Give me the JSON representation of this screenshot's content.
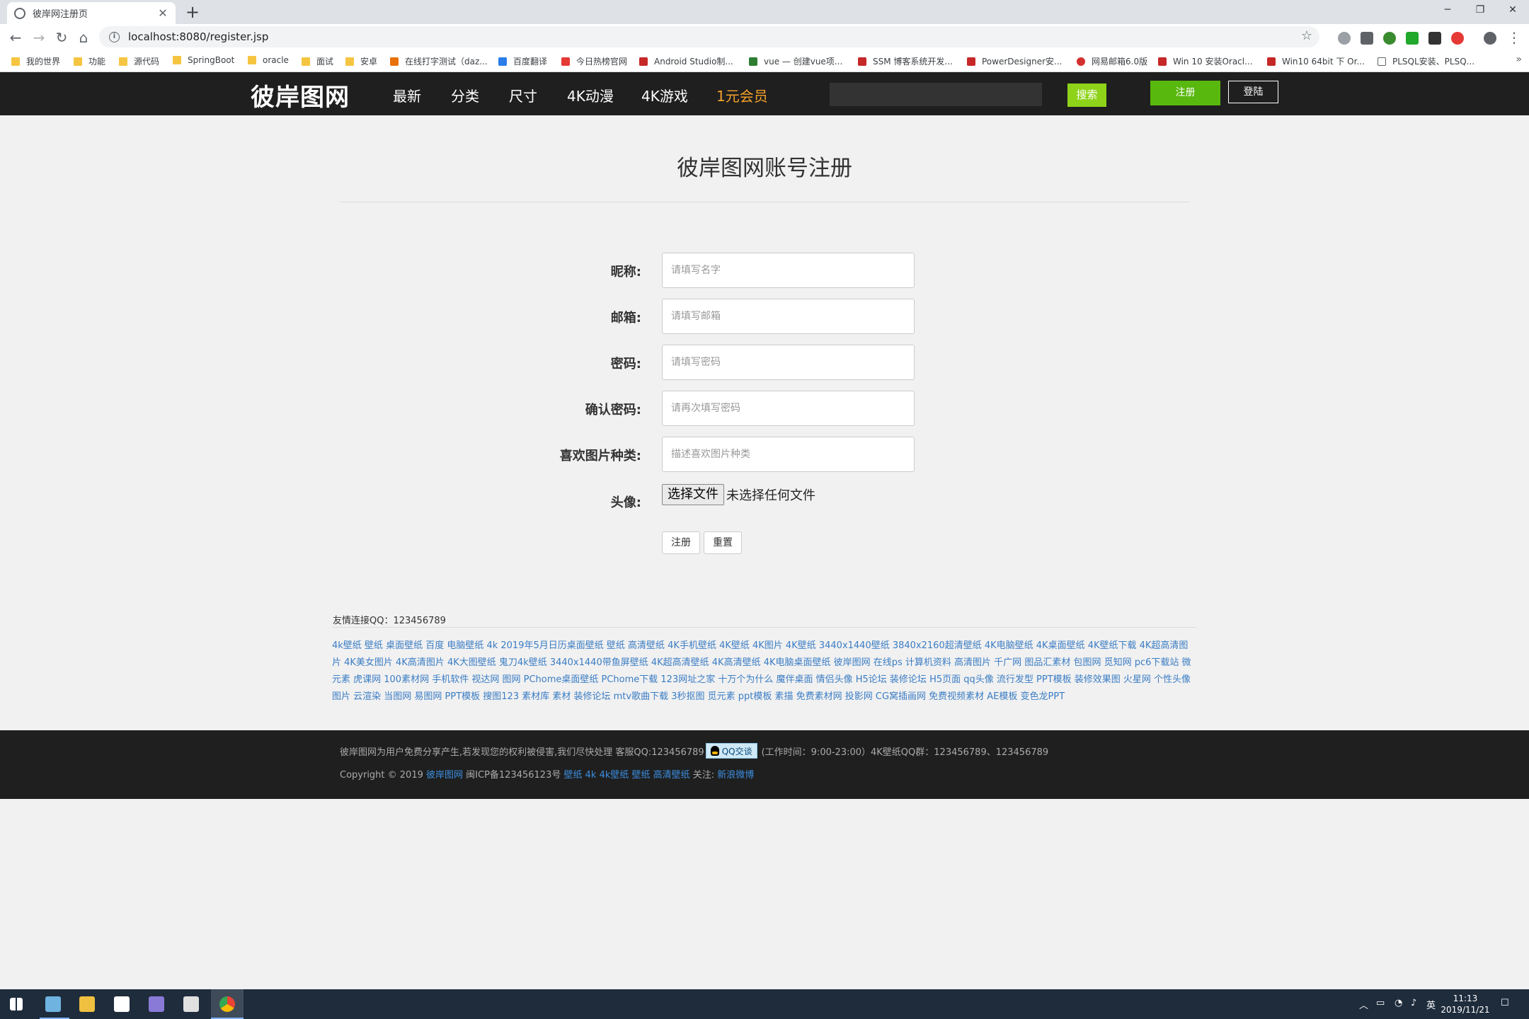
{
  "browser": {
    "tab_title": "彼岸网注册页",
    "url": "localhost:8080/register.jsp",
    "bookmarks": [
      "我的世界",
      "功能",
      "源代码",
      "SpringBoot",
      "oracle",
      "面试",
      "安卓",
      "在线打字测试（daz...",
      "百度翻译",
      "今日热榜官网",
      "Android Studio制...",
      "vue — 创建vue项...",
      "SSM 博客系统开发...",
      "PowerDesigner安...",
      "网易邮箱6.0版",
      "Win 10 安装Oracl...",
      "Win10 64bit 下 Or...",
      "PLSQL安装、PLSQ..."
    ]
  },
  "site": {
    "logo": "彼岸图网",
    "nav": [
      "最新",
      "分类",
      "尺寸",
      "4K动漫",
      "4K游戏",
      "1元会员"
    ],
    "search_btn": "搜索",
    "register_btn": "注册",
    "login_btn": "登陆"
  },
  "form": {
    "title": "彼岸图网账号注册",
    "fields": [
      {
        "label": "昵称:",
        "placeholder": "请填写名字"
      },
      {
        "label": "邮箱:",
        "placeholder": "请填写邮箱"
      },
      {
        "label": "密码:",
        "placeholder": "请填写密码"
      },
      {
        "label": "确认密码:",
        "placeholder": "请再次填写密码"
      },
      {
        "label": "喜欢图片种类:",
        "placeholder": "描述喜欢图片种类"
      }
    ],
    "avatar_label": "头像:",
    "file_button": "选择文件",
    "file_status": "未选择任何文件",
    "submit": "注册",
    "reset": "重置"
  },
  "links": {
    "friend": "友情连接QQ：123456789",
    "text": "4k壁纸 壁纸 桌面壁纸 百度 电脑壁纸 4k 2019年5月日历桌面壁纸 壁纸 高清壁纸 4K手机壁纸 4K壁纸 4K图片 4K壁纸 3440x1440壁纸 3840x2160超清壁纸 4K电脑壁纸 4K桌面壁纸 4K壁纸下载 4K超高清图片 4K美女图片 4K高清图片 4K大图壁纸 鬼刀4k壁纸 3440x1440带鱼屏壁纸 4K超高清壁纸 4K高清壁纸 4K电脑桌面壁纸 彼岸图网 在线ps 计算机资料 高清图片 千广网 图品汇素材 包图网 觅知网 pc6下载站 微元素 虎课网 100素材网 手机软件 视达网 图网 PChome桌面壁纸 PChome下载 123网址之家 十万个为什么 魔伴桌面 情侣头像 H5论坛 装修论坛 H5页面 qq头像 流行发型 PPT模板 装修效果图 火星网 个性头像图片 云渲染 当图网 易图网 PPT模板 搜图123 素材库 素材 装修论坛 mtv歌曲下载 3秒抠图 觅元素 ppt模板 素描 免费素材网 投影网 CG窝插画网 免费视频素材 AE模板 变色龙PPT"
  },
  "footer": {
    "line1_a": "彼岸图网为用户免费分享产生,若发现您的权利被侵害,我们尽快处理 客服QQ:123456789",
    "qq_badge": "QQ交谈",
    "line1_b": "(工作时间：9:00-23:00）4K壁纸QQ群：123456789、123456789",
    "copyright": "Copyright © 2019 ",
    "site_link": "彼岸图网",
    "icp": " 闽ICP备123456123号 ",
    "keywords": "壁纸 4k 4k壁纸 壁纸 高清壁纸",
    "follow": " 关注: ",
    "weibo": "新浪微博"
  },
  "taskbar": {
    "ime": "英",
    "time": "11:13",
    "date": "2019/11/21"
  },
  "colors": {
    "header_bg": "#1f1f1f",
    "search_green": "#8ed319",
    "register_green": "#59b80e",
    "vip_orange": "#f4a12b",
    "link_blue": "#3b7dc4"
  }
}
